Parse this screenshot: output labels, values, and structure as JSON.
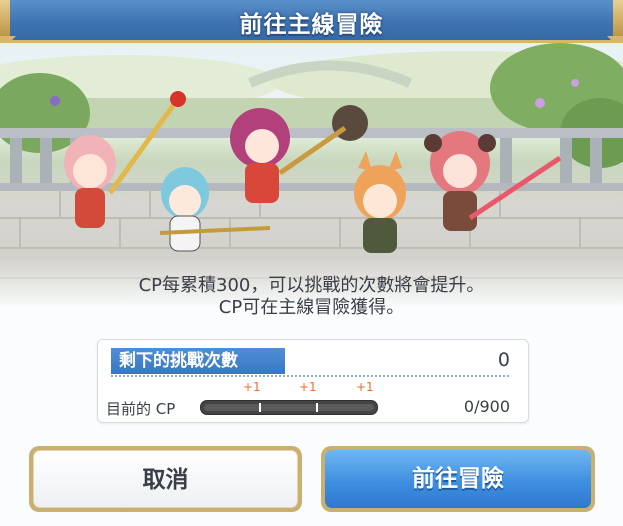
{
  "title": "前往主線冒險",
  "message": {
    "line1": "CP每累積300，可以挑戰的次數將會提升。",
    "line2": "CP可在主線冒險獲得。"
  },
  "status": {
    "remaining_label": "剩下的挑戰次數",
    "remaining_value": "0",
    "increments": [
      "+1",
      "+1",
      "+1"
    ],
    "cp_label": "目前的 CP",
    "cp_value": "0/900",
    "cp_progress": 0
  },
  "buttons": {
    "cancel": "取消",
    "go": "前往冒險"
  },
  "colors": {
    "title_bar": "#3f74b3",
    "go_button": "#3f8fe0",
    "increment": "#f26a2c",
    "gold_frame": "#c9b071"
  }
}
